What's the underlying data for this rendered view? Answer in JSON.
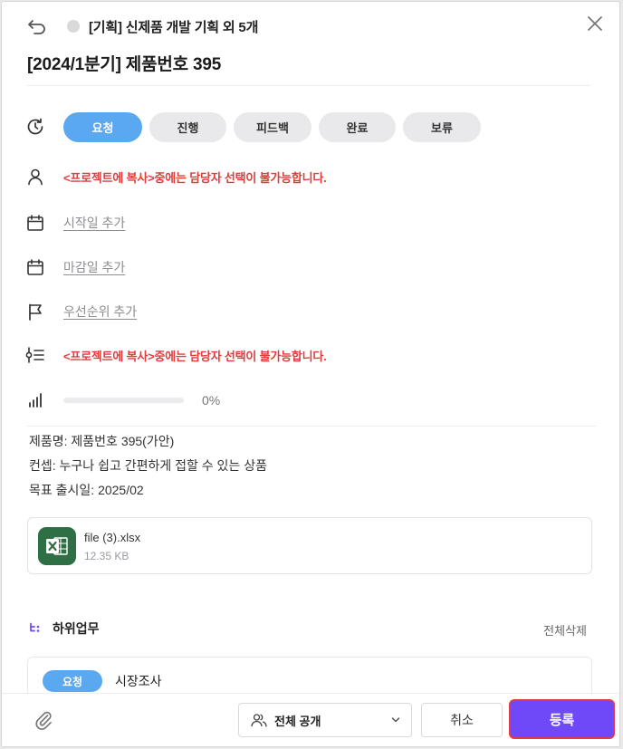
{
  "header": {
    "breadcrumb": "[기획] 신제품 개발 기획 외 5개",
    "title": "[2024/1분기] 제품번호 395"
  },
  "status": {
    "options": [
      "요청",
      "진행",
      "피드백",
      "완료",
      "보류"
    ],
    "active_index": 0
  },
  "fields": {
    "assignee_notice": "<프로젝트에 복사>중에는 담당자 선택이 불가능합니다.",
    "start_date": "시작일 추가",
    "due_date": "마감일 추가",
    "priority": "우선순위 추가",
    "filter_notice": "<프로젝트에 복사>중에는 담당자 선택이 불가능합니다.",
    "progress_percent": 0,
    "progress_label": "0%"
  },
  "description": {
    "lines": [
      "제품명: 제품번호 395(가안)",
      "컨셉: 누구나 쉽고 간편하게 접할 수 있는 상품",
      "목표 출시일: 2025/02"
    ]
  },
  "attachment": {
    "name": "file (3).xlsx",
    "size": "12.35 KB",
    "icon": "excel-icon"
  },
  "subtasks": {
    "title": "하위업무",
    "delete_all": "전체삭제",
    "items": [
      {
        "status": "요청",
        "name": "시장조사"
      }
    ]
  },
  "footer": {
    "visibility": "전체 공개",
    "cancel": "취소",
    "submit": "등록"
  },
  "colors": {
    "accent": "#5aa8f0",
    "warning": "#e03c3c",
    "primary": "#6f49f7",
    "excel": "#2f6f45"
  }
}
